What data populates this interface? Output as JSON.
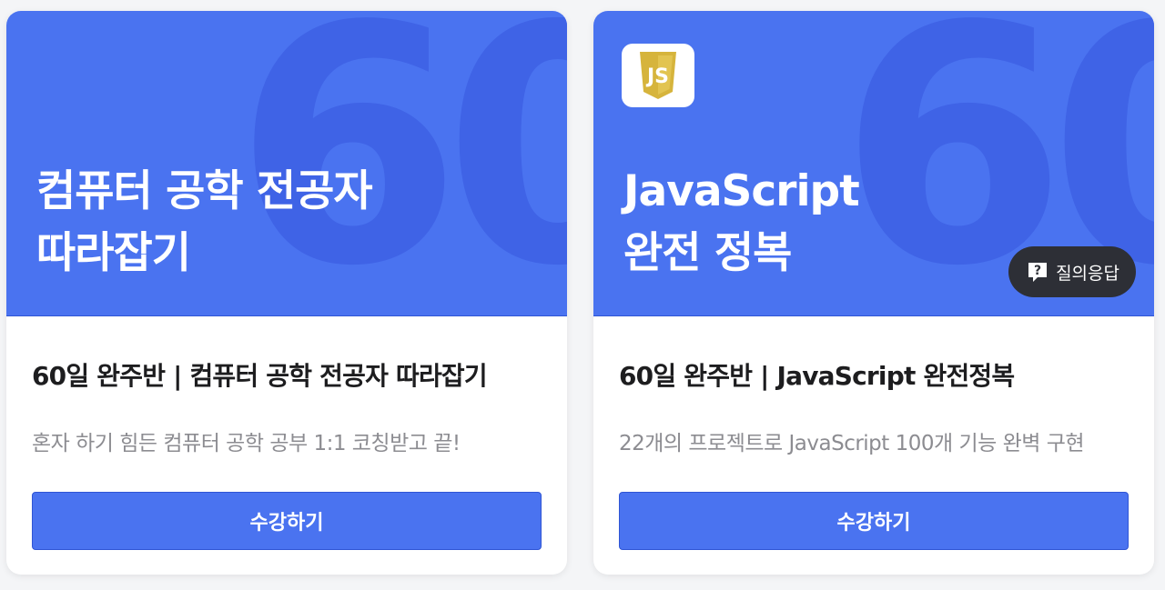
{
  "cards": [
    {
      "bg_number": "60",
      "banner_title_line1": "컴퓨터 공학 전공자",
      "banner_title_line2": "따라잡기",
      "title": "60일 완주반  |  컴퓨터 공학 전공자 따라잡기",
      "subtitle": "혼자 하기 힘든 컴퓨터 공학 공부 1:1 코칭받고 끝!",
      "button_label": "수강하기"
    },
    {
      "bg_number": "60",
      "logo_icon": "javascript-logo-icon",
      "banner_title_line1": "JavaScript",
      "banner_title_line2": "완전 정복",
      "qa_label": "질의응답",
      "title": "60일 완주반 | JavaScript 완전정복",
      "subtitle": "22개의 프로젝트로 JavaScript 100개 기능 완벽 구현",
      "button_label": "수강하기"
    }
  ],
  "colors": {
    "banner_blue": "#4a73f0",
    "banner_number_blue": "#3f63e6",
    "qa_pill_dark": "#2d2f36",
    "js_logo_yellow": "#d6b43c"
  }
}
